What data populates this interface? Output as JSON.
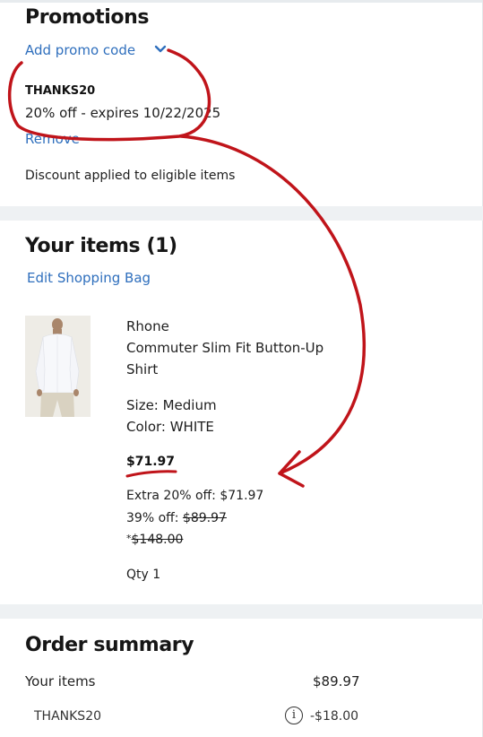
{
  "promotions": {
    "title": "Promotions",
    "add_promo_label": "Add promo code",
    "code": "THANKS20",
    "description": "20% off - expires 10/22/2025",
    "remove_label": "Remove",
    "note": "Discount applied to eligible items"
  },
  "items": {
    "title": "Your items (1)",
    "edit_label": "Edit Shopping Bag",
    "product": {
      "brand": "Rhone",
      "name_line1": "Commuter Slim Fit Button-Up",
      "name_line2": "Shirt",
      "size": "Size: Medium",
      "color": "Color: WHITE",
      "price": "$71.97",
      "extra_off": "Extra 20% off: $71.97",
      "pct_off_label": "39% off: ",
      "pct_off_price": "$89.97",
      "orig_prefix": "*",
      "orig_price": "$148.00",
      "qty": "Qty 1"
    }
  },
  "summary": {
    "title": "Order summary",
    "items_label": "Your items",
    "items_value": "$89.97",
    "promo_label": "THANKS20",
    "promo_value": "-$18.00"
  },
  "colors": {
    "link": "#2f6fbd",
    "annotation_red": "#c0141a",
    "divider": "#eef1f3"
  },
  "icons": [
    "chevron-down-icon",
    "info-icon",
    "product-image"
  ]
}
